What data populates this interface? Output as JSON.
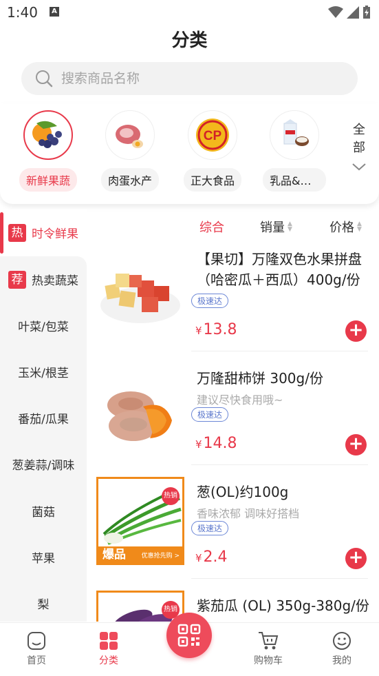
{
  "status": {
    "time": "1:40",
    "a_label": "A"
  },
  "header": {
    "title": "分类"
  },
  "search": {
    "placeholder": "搜索商品名称"
  },
  "categories": [
    {
      "label": "新鲜果蔬",
      "icon": "fruit-basket-icon",
      "active": true
    },
    {
      "label": "肉蛋水产",
      "icon": "meat-egg-icon",
      "active": false
    },
    {
      "label": "正大食品",
      "icon": "cp-logo-icon",
      "active": false
    },
    {
      "label": "乳品&冷…",
      "icon": "dairy-icon",
      "active": false
    }
  ],
  "all_button": {
    "line1": "全",
    "line2": "部"
  },
  "sidebar": {
    "items": [
      {
        "label": "时令鲜果",
        "tag": "热"
      },
      {
        "label": "热卖蔬菜",
        "tag": "荐"
      },
      {
        "label": "叶菜/包菜"
      },
      {
        "label": "玉米/根茎"
      },
      {
        "label": "番茄/瓜果"
      },
      {
        "label": "葱姜蒜/调味"
      },
      {
        "label": "菌菇"
      },
      {
        "label": "苹果"
      },
      {
        "label": "梨"
      }
    ]
  },
  "sort": {
    "overall": "综合",
    "sales": "销量",
    "price": "价格"
  },
  "products": [
    {
      "name": "【果切】万隆双色水果拼盘（哈密瓜＋西瓜）400g/份",
      "subtitle": "",
      "badge": "极速达",
      "currency": "¥",
      "price": "13.8"
    },
    {
      "name": "万隆甜柿饼 300g/份",
      "subtitle": "建议尽快食用哦~",
      "badge": "极速达",
      "currency": "¥",
      "price": "14.8"
    },
    {
      "name": "葱(OL)约100g",
      "subtitle": "香味浓郁 调味好搭档",
      "badge": "极速达",
      "currency": "¥",
      "price": "2.4",
      "promo_tag": "热销",
      "promo_banner": "爆品",
      "promo_sub": "优惠抢先购 >"
    },
    {
      "name": "紫茄瓜 (OL) 350g-380g/份",
      "subtitle": "",
      "badge": "",
      "promo_tag": "热销"
    }
  ],
  "tabbar": {
    "home": "首页",
    "category": "分类",
    "cart": "购物车",
    "mine": "我的"
  },
  "colors": {
    "accent": "#e8394a",
    "badge": "#5b77cc",
    "bg_gray": "#f5f5f5"
  }
}
